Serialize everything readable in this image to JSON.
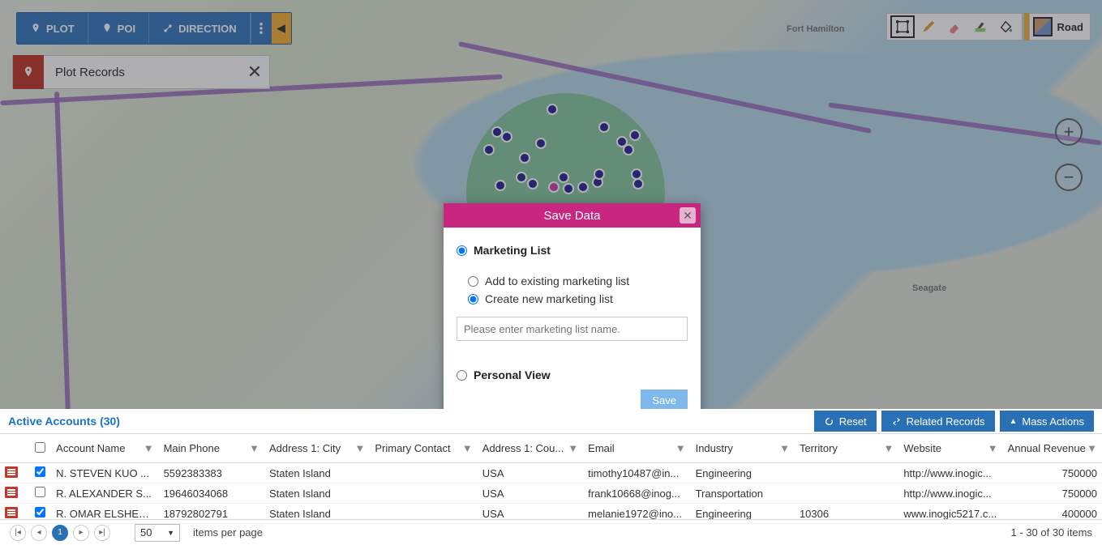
{
  "ribbon": {
    "plot": "PLOT",
    "poi": "POI",
    "direction": "DIRECTION"
  },
  "plot_card": {
    "title": "Plot Records"
  },
  "map_type": {
    "label": "Road"
  },
  "modal": {
    "title": "Save Data",
    "option_marketing": "Marketing List",
    "sub_add": "Add to existing marketing list",
    "sub_create": "Create new marketing list",
    "placeholder": "Please enter marketing list name.",
    "option_personal": "Personal View",
    "save": "Save"
  },
  "bottom": {
    "active_accounts": "Active Accounts (30)",
    "reset": "Reset",
    "related": "Related Records",
    "mass": "Mass Actions"
  },
  "columns": {
    "c0": "",
    "c1": "",
    "c2": "Account Name",
    "c3": "Main Phone",
    "c4": "Address 1: City",
    "c5": "Primary Contact",
    "c6": "Address 1: Cou...",
    "c7": "Email",
    "c8": "Industry",
    "c9": "Territory",
    "c10": "Website",
    "c11": "Annual Revenue"
  },
  "rows": {
    "r0": {
      "name": "N. STEVEN KUO ...",
      "phone": "5592383383",
      "city": "Staten Island",
      "contact": "",
      "country": "USA",
      "email": "timothy10487@in...",
      "industry": "Engineering",
      "territory": "",
      "website": "http://www.inogic...",
      "rev": "750000",
      "checked": true
    },
    "r1": {
      "name": "R. ALEXANDER S...",
      "phone": "19646034068",
      "city": "Staten Island",
      "contact": "",
      "country": "USA",
      "email": "frank10668@inog...",
      "industry": "Transportation",
      "territory": "",
      "website": "http://www.inogic...",
      "rev": "750000",
      "checked": false
    },
    "r2": {
      "name": "R. OMAR ELSHERI...",
      "phone": "18792802791",
      "city": "Staten Island",
      "contact": "",
      "country": "USA",
      "email": "melanie1972@ino...",
      "industry": "Engineering",
      "territory": "10306",
      "website": "www.inogic5217.c...",
      "rev": "400000",
      "checked": true
    }
  },
  "pager": {
    "page": "1",
    "size": "50",
    "label": "items per page",
    "count": "1 - 30 of 30 items"
  }
}
